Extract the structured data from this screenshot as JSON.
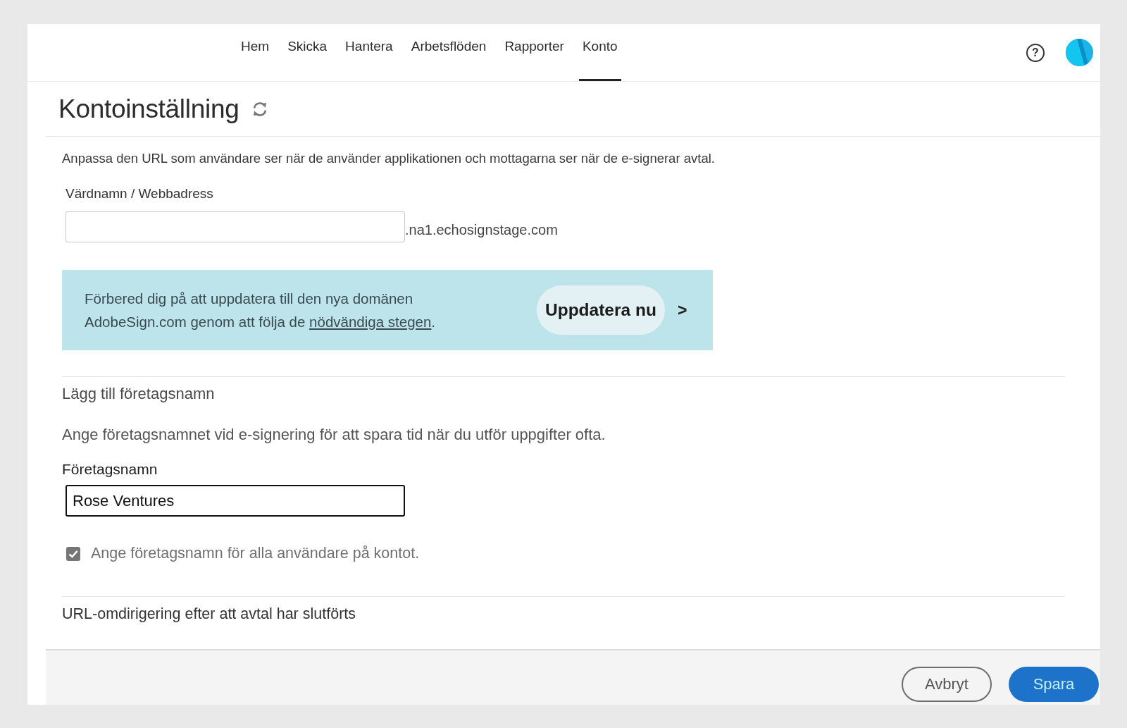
{
  "nav": {
    "tabs": [
      {
        "label": "Hem",
        "selected": false
      },
      {
        "label": "Skicka",
        "selected": false
      },
      {
        "label": "Hantera",
        "selected": false
      },
      {
        "label": "Arbetsflöden",
        "selected": false
      },
      {
        "label": "Rapporter",
        "selected": false
      },
      {
        "label": "Konto",
        "selected": true
      }
    ],
    "help_icon_label": "?"
  },
  "page": {
    "title": "Kontoinställning"
  },
  "url_section": {
    "description": "Anpassa den URL som användare ser när de använder applikationen och mottagarna ser när de e-signerar avtal.",
    "field_label": "Värdnamn / Webbadress",
    "suffix": ".na1.echosignstage.com"
  },
  "banner": {
    "text_before": "Förbered dig på att uppdatera till den nya domänen AdobeSign.com genom att följa de ",
    "link": "nödvändiga stegen",
    "text_after": ".",
    "button": "Uppdatera nu",
    "arrow": ">"
  },
  "company_section": {
    "heading": "Lägg till företagsnamn",
    "description": "Ange företagsnamnet vid e-signering för att spara tid när du utför uppgifter ofta.",
    "field_label": "Företagsnamn",
    "value": "Rose Ventures",
    "checkbox": {
      "label": "Ange företagsnamn för alla användare på kontot.",
      "checked": true
    }
  },
  "redirect_section": {
    "heading": "URL-omdirigering efter att avtal har slutförts"
  },
  "footer": {
    "buttons": [
      {
        "label": "Avbryt",
        "kind": "secondary"
      },
      {
        "label": "Spara",
        "kind": "primary"
      }
    ]
  }
}
